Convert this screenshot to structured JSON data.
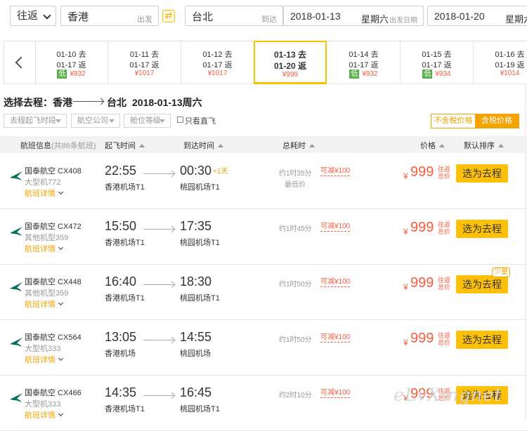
{
  "search": {
    "trip_type": "往返",
    "from_city": "香港",
    "from_hint": "出发",
    "to_city": "台北",
    "to_hint": "到达",
    "depart_date": "2018-01-13",
    "depart_weekday": "星期六",
    "depart_hint": "出发日期",
    "return_date": "2018-01-20",
    "return_weekday": "星期六",
    "swap_icon": "swap-icon"
  },
  "date_strip": [
    {
      "go": "01-10 去",
      "ret": "01-17 返",
      "low": "低",
      "price": "¥932"
    },
    {
      "go": "01-11 去",
      "ret": "01-17 返",
      "low": "",
      "price": "¥1017"
    },
    {
      "go": "01-12 去",
      "ret": "01-17 返",
      "low": "",
      "price": "¥1017"
    },
    {
      "go": "01-13 去",
      "ret": "01-20 返",
      "low": "",
      "price": "¥999"
    },
    {
      "go": "01-14 去",
      "ret": "01-17 返",
      "low": "低",
      "price": "¥932"
    },
    {
      "go": "01-15 去",
      "ret": "01-17 返",
      "low": "低",
      "price": "¥934"
    },
    {
      "go": "01-16 去",
      "ret": "01-19 返",
      "low": "",
      "price": "¥1014"
    }
  ],
  "title": {
    "prefix": "选择去程：香港",
    "to": "台北",
    "date": "2018-01-13周六"
  },
  "filters": {
    "time": "去程起飞时段",
    "airline": "航空公司",
    "cabin": "舱位等级",
    "nonstop": "只看直飞",
    "tax_excl": "不含税价格",
    "tax_incl": "含税价格"
  },
  "header": {
    "info": "航班信息",
    "info_count": "(共86条航班)",
    "dep": "起飞时间",
    "arr": "到达时间",
    "duration": "总耗时",
    "price": "价格",
    "sort": "默认排序"
  },
  "flights": [
    {
      "airline": "国泰航空 CX408",
      "plane": "大型机772",
      "detail": "航班详情",
      "dep": "22:55",
      "dep_ap": "香港机场T1",
      "arr": "00:30",
      "plus": "+1天",
      "arr_ap": "桃园机场T1",
      "dur": "约1时35分",
      "lowest": "最低价",
      "discount": "可减¥100",
      "yen": "¥",
      "price": "999",
      "tax": "往返总价",
      "btn": "选为去程",
      "few": ""
    },
    {
      "airline": "国泰航空 CX472",
      "plane": "其他机型359",
      "detail": "航班详情",
      "dep": "15:50",
      "dep_ap": "香港机场T1",
      "arr": "17:35",
      "plus": "",
      "arr_ap": "桃园机场T1",
      "dur": "约1时45分",
      "lowest": "",
      "discount": "可减¥100",
      "yen": "¥",
      "price": "999",
      "tax": "往返总价",
      "btn": "选为去程",
      "few": ""
    },
    {
      "airline": "国泰航空 CX448",
      "plane": "其他机型359",
      "detail": "航班详情",
      "dep": "16:40",
      "dep_ap": "香港机场T1",
      "arr": "18:30",
      "plus": "",
      "arr_ap": "桃园机场T1",
      "dur": "约1时50分",
      "lowest": "",
      "discount": "可减¥100",
      "yen": "¥",
      "price": "999",
      "tax": "往返总价",
      "btn": "选为去程",
      "few": "少量"
    },
    {
      "airline": "国泰航空 CX564",
      "plane": "大型机333",
      "detail": "航班详情",
      "dep": "13:05",
      "dep_ap": "香港机场",
      "arr": "14:55",
      "plus": "",
      "arr_ap": "桃园机场",
      "dur": "约1时50分",
      "lowest": "",
      "discount": "可减¥100",
      "yen": "¥",
      "price": "999",
      "tax": "往返总价",
      "btn": "选为去程",
      "few": ""
    },
    {
      "airline": "国泰航空 CX466",
      "plane": "大型机333",
      "detail": "航班详情",
      "dep": "14:35",
      "dep_ap": "香港机场T1",
      "arr": "16:45",
      "plus": "",
      "arr_ap": "桃园机场T1",
      "dur": "约2时10分",
      "lowest": "",
      "discount": "可减¥100",
      "yen": "¥",
      "price": "999",
      "tax": "往返总价",
      "btn": "选为去程",
      "few": ""
    }
  ],
  "watermark": "eLvXingnet",
  "colors": {
    "accent": "#ffc107",
    "price": "#ff5a3c",
    "orange": "#f5a300",
    "low": "#5bb14b"
  }
}
